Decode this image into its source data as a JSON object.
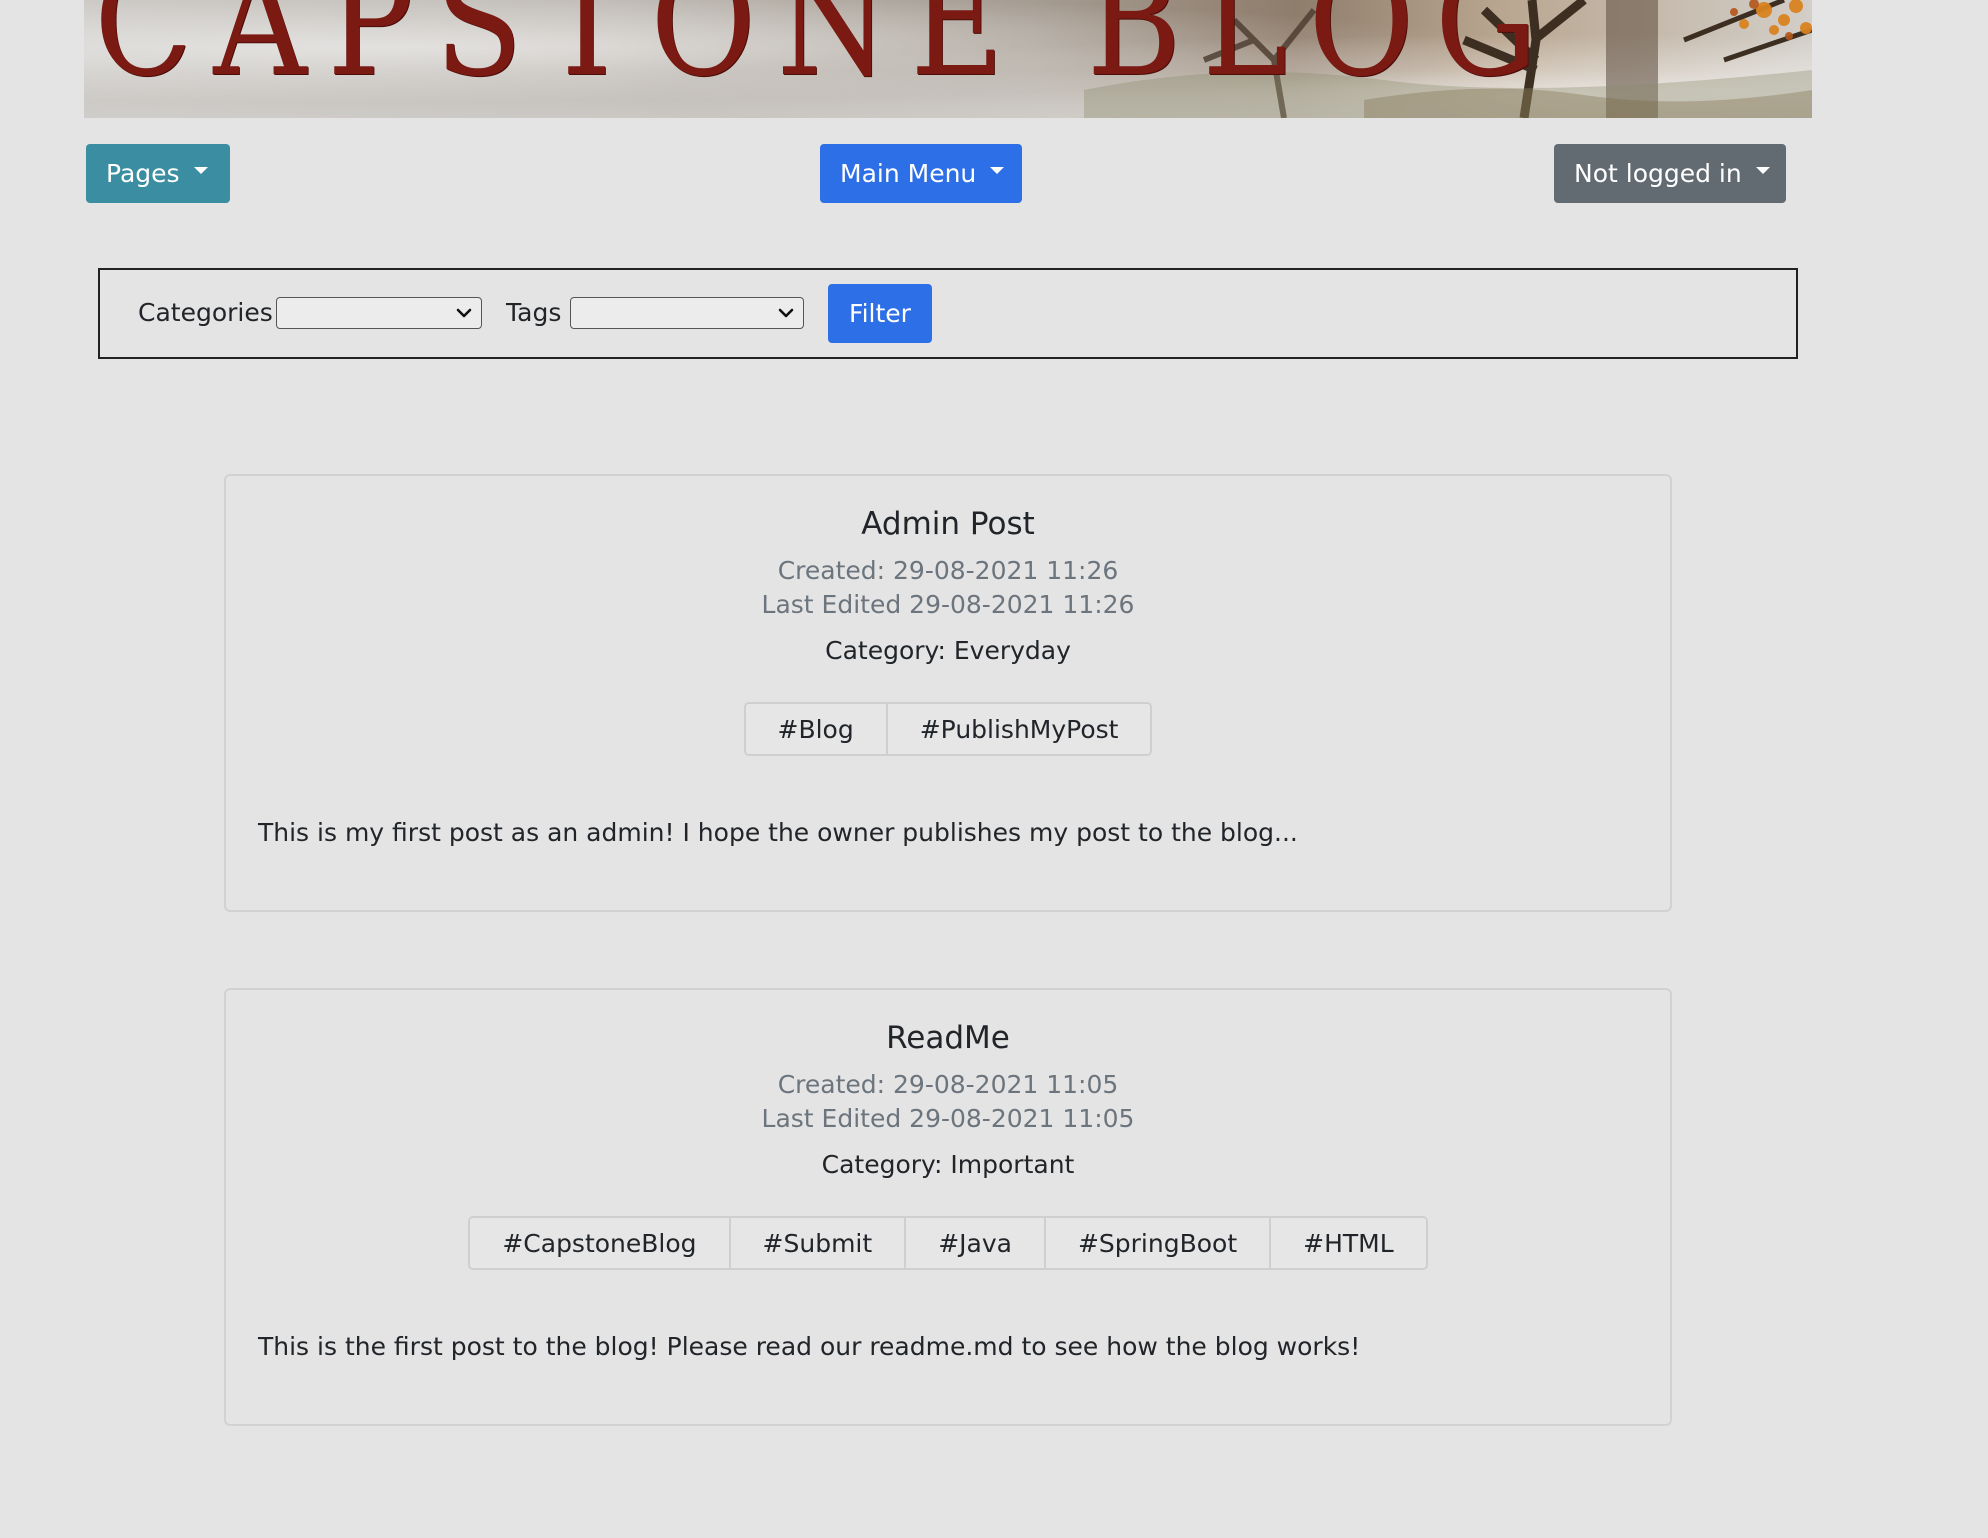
{
  "banner": {
    "title": "CAPSTONE BLOG"
  },
  "nav": {
    "pages_label": "Pages",
    "main_menu_label": "Main Menu",
    "user_label": "Not logged in"
  },
  "filter": {
    "categories_label": "Categories",
    "categories_value": "",
    "tags_label": "Tags",
    "tags_value": "",
    "filter_button": "Filter"
  },
  "posts": [
    {
      "title": "Admin Post",
      "created": "Created: 29-08-2021 11:26",
      "edited": "Last Edited 29-08-2021 11:26",
      "category": "Category: Everyday",
      "tags": [
        "#Blog",
        "#PublishMyPost"
      ],
      "body": "This is my first post as an admin! I hope the owner publishes my post to the blog..."
    },
    {
      "title": "ReadMe",
      "created": "Created: 29-08-2021 11:05",
      "edited": "Last Edited 29-08-2021 11:05",
      "category": "Category: Important",
      "tags": [
        "#CapstoneBlog",
        "#Submit",
        "#Java",
        "#SpringBoot",
        "#HTML"
      ],
      "body": "This is the first post to the blog! Please read our readme.md to see how the blog works!"
    }
  ],
  "colors": {
    "pages_button": "#3b8ea2",
    "primary": "#2c6fe6",
    "secondary": "#626a72",
    "banner_text": "#7b1a12"
  }
}
